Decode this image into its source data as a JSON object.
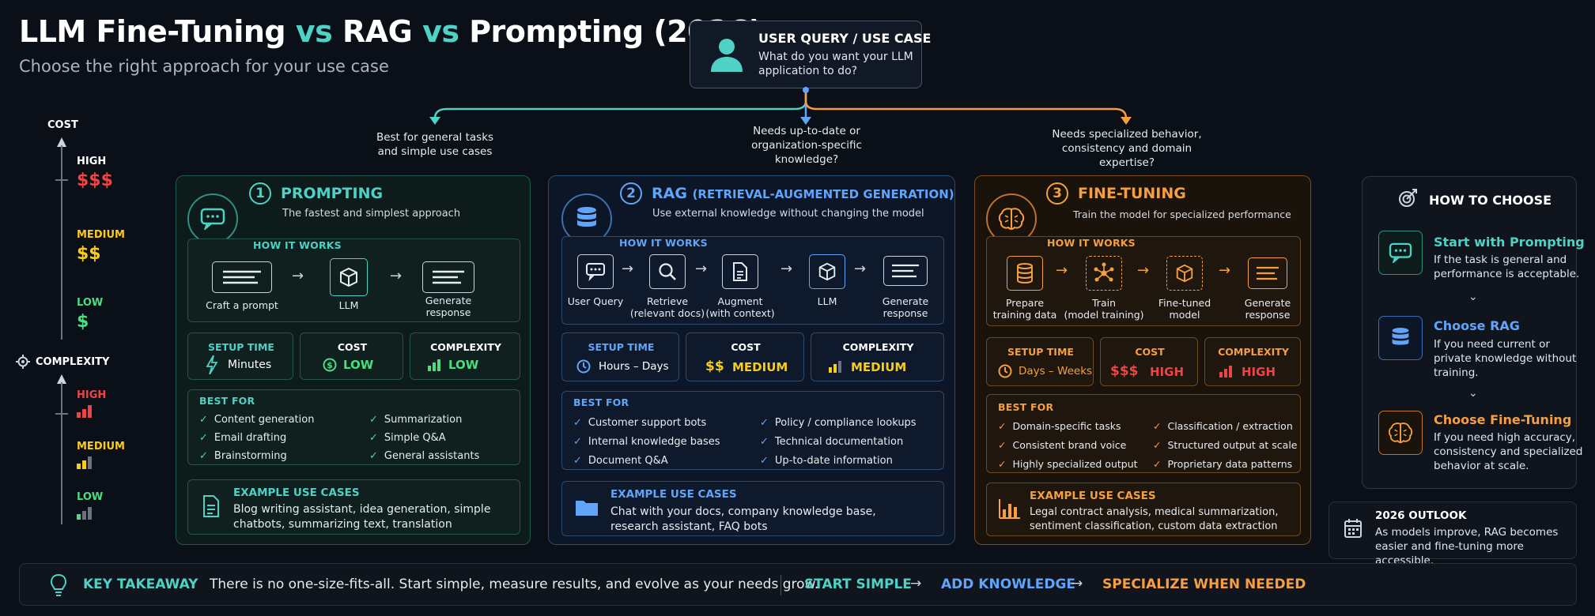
{
  "header": {
    "title_part1": "LLM Fine-Tuning",
    "vs": "vs",
    "title_part2": "RAG",
    "title_part3": "Prompting (2026)",
    "subtitle": "Choose the right approach for your use case"
  },
  "query": {
    "title": "USER QUERY / USE CASE",
    "text": "What do you want your LLM application to do?"
  },
  "branches": {
    "left": [
      "Best for general tasks",
      "and simple use cases"
    ],
    "middle": [
      "Needs up-to-date or",
      "organization-specific",
      "knowledge?"
    ],
    "right": [
      "Needs specialized behavior,",
      "consistency and domain",
      "expertise?"
    ]
  },
  "axes": {
    "cost": {
      "title": "COST",
      "high": "HIGH",
      "high_sym": "$$$",
      "medium": "MEDIUM",
      "medium_sym": "$$",
      "low": "LOW",
      "low_sym": "$"
    },
    "complexity": {
      "title": "COMPLEXITY",
      "high": "HIGH",
      "medium": "MEDIUM",
      "low": "LOW"
    }
  },
  "colors": {
    "teal": "#4fd1c5",
    "blue": "#60a5fa",
    "orange": "#f59e42",
    "red": "#ef4444",
    "yellow": "#facc15",
    "green": "#4ade80"
  },
  "prompting": {
    "num": "1",
    "title": "PROMPTING",
    "subtitle": "The fastest and simplest approach",
    "how_label": "HOW IT WORKS",
    "steps": [
      "Craft a prompt",
      "LLM",
      "Generate",
      "response"
    ],
    "stats": {
      "setup_head": "SETUP TIME",
      "setup_val": "Minutes",
      "cost_head": "COST",
      "cost_val": "LOW",
      "cx_head": "COMPLEXITY",
      "cx_val": "LOW"
    },
    "best_label": "BEST FOR",
    "best": [
      "Content generation",
      "Email drafting",
      "Brainstorming",
      "Summarization",
      "Simple Q&A",
      "General assistants"
    ],
    "ex_label": "EXAMPLE USE CASES",
    "ex_text": "Blog writing assistant, idea generation, simple chatbots, summarizing text, translation"
  },
  "rag": {
    "num": "2",
    "title": "RAG",
    "title_paren": "(RETRIEVAL-AUGMENTED GENERATION)",
    "subtitle": "Use external knowledge without changing the model",
    "how_label": "HOW IT WORKS",
    "steps": [
      [
        "User Query"
      ],
      [
        "Retrieve",
        "(relevant docs)"
      ],
      [
        "Augment",
        "(with context)"
      ],
      [
        "LLM"
      ],
      [
        "Generate",
        "response"
      ]
    ],
    "stats": {
      "setup_head": "SETUP TIME",
      "setup_val": "Hours – Days",
      "cost_head": "COST",
      "cost_sym": "$$",
      "cost_val": "MEDIUM",
      "cx_head": "COMPLEXITY",
      "cx_val": "MEDIUM"
    },
    "best_label": "BEST FOR",
    "best": [
      "Customer support bots",
      "Internal knowledge bases",
      "Document Q&A",
      "Policy / compliance lookups",
      "Technical documentation",
      "Up-to-date information"
    ],
    "ex_label": "EXAMPLE USE CASES",
    "ex_text": "Chat with your docs, company knowledge base, research assistant, FAQ bots"
  },
  "finetune": {
    "num": "3",
    "title": "FINE-TUNING",
    "subtitle": "Train the model for specialized performance",
    "how_label": "HOW IT WORKS",
    "steps": [
      [
        "Prepare",
        "training data"
      ],
      [
        "Train",
        "(model training)"
      ],
      [
        "Fine-tuned",
        "model"
      ],
      [
        "Generate",
        "response"
      ]
    ],
    "stats": {
      "setup_head": "SETUP TIME",
      "setup_val": "Days – Weeks",
      "cost_head": "COST",
      "cost_sym": "$$$",
      "cost_val": "HIGH",
      "cx_head": "COMPLEXITY",
      "cx_val": "HIGH"
    },
    "best_label": "BEST FOR",
    "best": [
      "Domain-specific tasks",
      "Consistent brand voice",
      "Highly specialized output",
      "Classification / extraction",
      "Structured output at scale",
      "Proprietary data patterns"
    ],
    "ex_label": "EXAMPLE USE CASES",
    "ex_text": "Legal contract analysis, medical summarization, sentiment classification, custom data extraction"
  },
  "how": {
    "title": "HOW TO CHOOSE",
    "items": [
      {
        "title": "Start with Prompting",
        "text": "If the task is general and performance is acceptable."
      },
      {
        "title": "Choose RAG",
        "text": "If you need current or private knowledge without training."
      },
      {
        "title": "Choose Fine-Tuning",
        "text": "If you need high accuracy, consistency and specialized behavior at scale."
      }
    ]
  },
  "outlook": {
    "title": "2026 OUTLOOK",
    "text": "As models improve, RAG becomes easier and fine-tuning more accessible."
  },
  "takeaway": {
    "label": "KEY TAKEAWAY",
    "text": "There is no one-size-fits-all.  Start simple, measure results, and evolve as your needs grow.",
    "step1": "START SIMPLE",
    "step2": "ADD KNOWLEDGE",
    "step3": "SPECIALIZE WHEN NEEDED"
  }
}
